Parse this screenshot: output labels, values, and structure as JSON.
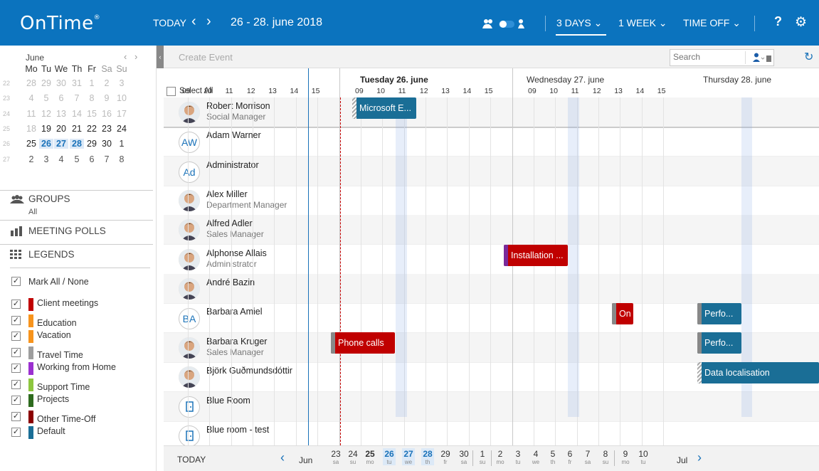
{
  "app": {
    "name": "OnTime",
    "mark": "®"
  },
  "header": {
    "today_label": "TODAY",
    "prev_icon": "‹",
    "next_icon": "›",
    "date_range": "26  -  28. june 2018",
    "view_3days": "3 DAYS",
    "view_1week": "1 WEEK",
    "view_timeoff": "TIME OFF",
    "help": "?"
  },
  "mini_calendar": {
    "month": "June",
    "weekdays": [
      "Mo",
      "Tu",
      "We",
      "Th",
      "Fr",
      "Sa",
      "Su"
    ],
    "weeks": [
      {
        "num": "22",
        "days": [
          "28",
          "29",
          "30",
          "31",
          "1",
          "2",
          "3"
        ]
      },
      {
        "num": "23",
        "days": [
          "4",
          "5",
          "6",
          "7",
          "8",
          "9",
          "10"
        ]
      },
      {
        "num": "24",
        "days": [
          "11",
          "12",
          "13",
          "14",
          "15",
          "16",
          "17"
        ]
      },
      {
        "num": "25",
        "days": [
          "18",
          "19",
          "20",
          "21",
          "22",
          "23",
          "24"
        ]
      },
      {
        "num": "26",
        "days": [
          "25",
          "26",
          "27",
          "28",
          "29",
          "30",
          "1"
        ]
      },
      {
        "num": "27",
        "days": [
          "2",
          "3",
          "4",
          "5",
          "6",
          "7",
          "8"
        ]
      }
    ]
  },
  "sidebar": {
    "groups_label": "GROUPS",
    "groups_value": "All",
    "polls_label": "MEETING POLLS",
    "legends_label": "LEGENDS",
    "mark_all": "Mark All / None",
    "legends": [
      {
        "label": "Client meetings",
        "color": "#c00000"
      },
      {
        "label": "Education",
        "color": "#f7941d"
      },
      {
        "label": "Vacation",
        "color": "#f7941d"
      },
      {
        "label": "Travel Time",
        "color": "#9e9e9e"
      },
      {
        "label": "Working from Home",
        "color": "#9b30d0"
      },
      {
        "label": "Support Time",
        "color": "#8dc63f"
      },
      {
        "label": "Projects",
        "color": "#2e6b1e"
      },
      {
        "label": "Other Time-Off",
        "color": "#8b0000"
      },
      {
        "label": "Default",
        "color": "#1a6e96"
      }
    ]
  },
  "toolbar": {
    "create_event": "Create Event",
    "search_placeholder": "Search"
  },
  "grid": {
    "select_all": "Select All",
    "days": [
      {
        "label": "Tuesday 26. june",
        "hours": [
          "09",
          "10",
          "11",
          "12",
          "13",
          "14",
          "15"
        ]
      },
      {
        "label": "Wednesday 27. june",
        "hours": [
          "09",
          "10",
          "11",
          "12",
          "13",
          "14",
          "15"
        ]
      },
      {
        "label": "Thursday 28. june",
        "hours": [
          "09",
          "10",
          "11",
          "12",
          "13",
          "14",
          "15"
        ]
      }
    ],
    "people": [
      {
        "name": "Robert Morrison",
        "role": "Social Manager"
      },
      {
        "name": "Adam Warner",
        "role": "",
        "initials": "AW"
      },
      {
        "name": "Administrator",
        "role": "",
        "initials": "Ad"
      },
      {
        "name": "Alex Miller",
        "role": "Department Manager"
      },
      {
        "name": "Alfred Adler",
        "role": "Sales Manager"
      },
      {
        "name": "Alphonse Allais",
        "role": "Administrator"
      },
      {
        "name": "André Bazin",
        "role": ""
      },
      {
        "name": "Barbara Amiel",
        "role": "",
        "initials": "BA"
      },
      {
        "name": "Barbara Kruger",
        "role": "Sales Manager"
      },
      {
        "name": "Björk Guðmundsdóttir",
        "role": ""
      },
      {
        "name": "Blue Room",
        "role": ""
      },
      {
        "name": "Blue room - test",
        "role": ""
      }
    ],
    "events": [
      {
        "label": "Microsoft E...",
        "color": "#1a6e96"
      },
      {
        "label": "Installation ...",
        "color": "#c00000"
      },
      {
        "label": "On",
        "color": "#c00000"
      },
      {
        "label": "Perfo...",
        "color": "#1a6e96"
      },
      {
        "label": "Phone calls",
        "color": "#c00000"
      },
      {
        "label": "Perfo...",
        "color": "#1a6e96"
      },
      {
        "label": "Data localisation",
        "color": "#1a6e96"
      }
    ]
  },
  "footer": {
    "today_label": "TODAY",
    "month_prev": "Jun",
    "month_next": "Jul",
    "days": [
      {
        "d": "23",
        "w": "sa"
      },
      {
        "d": "24",
        "w": "su"
      },
      {
        "d": "25",
        "w": "mo"
      },
      {
        "d": "26",
        "w": "tu"
      },
      {
        "d": "27",
        "w": "we"
      },
      {
        "d": "28",
        "w": "th"
      },
      {
        "d": "29",
        "w": "fr"
      },
      {
        "d": "30",
        "w": "sa"
      },
      {
        "d": "1",
        "w": "su"
      },
      {
        "d": "2",
        "w": "mo"
      },
      {
        "d": "3",
        "w": "tu"
      },
      {
        "d": "4",
        "w": "we"
      },
      {
        "d": "5",
        "w": "th"
      },
      {
        "d": "6",
        "w": "fr"
      },
      {
        "d": "7",
        "w": "sa"
      },
      {
        "d": "8",
        "w": "su"
      },
      {
        "d": "9",
        "w": "mo"
      },
      {
        "d": "10",
        "w": "tu"
      }
    ]
  }
}
